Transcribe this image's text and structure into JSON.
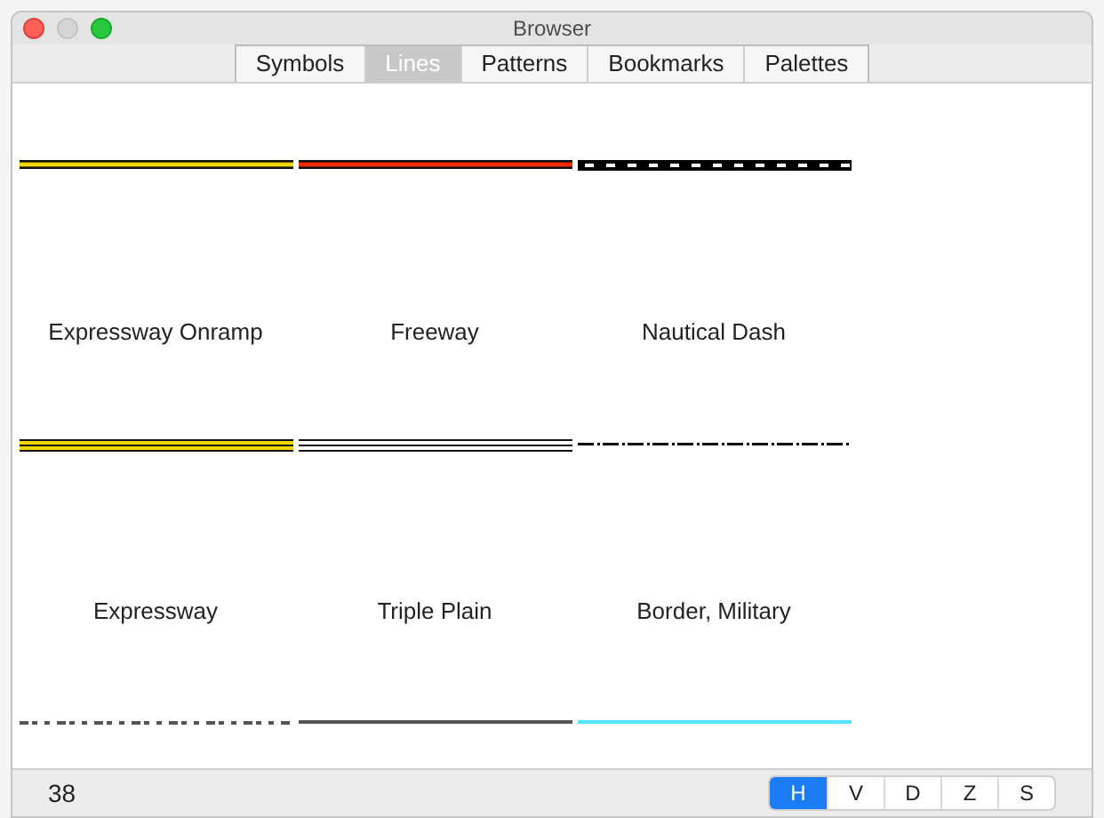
{
  "window": {
    "title": "Browser"
  },
  "tabs": [
    {
      "label": "Symbols",
      "selected": false
    },
    {
      "label": "Lines",
      "selected": true
    },
    {
      "label": "Patterns",
      "selected": false
    },
    {
      "label": "Bookmarks",
      "selected": false
    },
    {
      "label": "Palettes",
      "selected": false
    }
  ],
  "lines": [
    {
      "label": "Expressway Onramp",
      "kind": "outlined",
      "color": "#f2d600"
    },
    {
      "label": "Freeway",
      "kind": "outlined",
      "color": "#ff2a00"
    },
    {
      "label": "Nautical Dash",
      "kind": "dashed",
      "color": "#000000"
    },
    {
      "label": "Expressway",
      "kind": "triple",
      "color": "#f2d600"
    },
    {
      "label": "Triple Plain",
      "kind": "triple"
    },
    {
      "label": "Border, Military",
      "kind": "dashdot",
      "color": "#000000"
    },
    {
      "kind": "broken",
      "color": "#555555"
    },
    {
      "kind": "solid",
      "color": "#555555"
    },
    {
      "kind": "solid",
      "color": "#55e6ff"
    }
  ],
  "status_bar": {
    "count": "38",
    "segments": [
      {
        "label": "H",
        "selected": true
      },
      {
        "label": "V",
        "selected": false
      },
      {
        "label": "D",
        "selected": false
      },
      {
        "label": "Z",
        "selected": false
      },
      {
        "label": "S",
        "selected": false
      }
    ]
  }
}
